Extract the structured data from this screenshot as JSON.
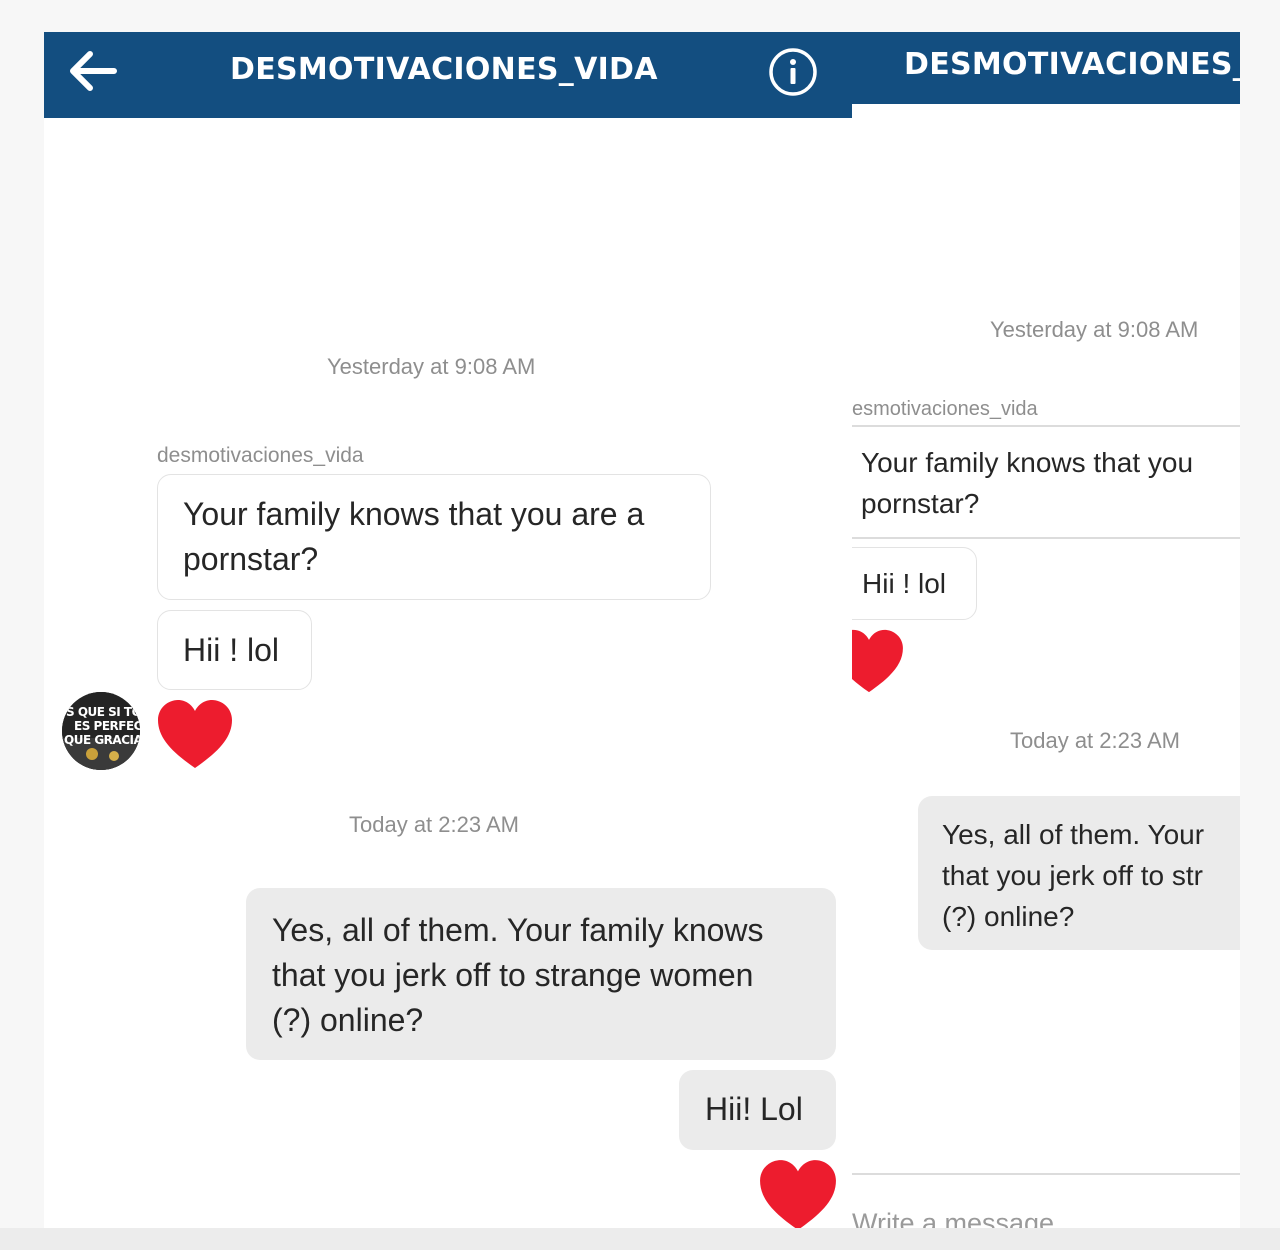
{
  "left_panel": {
    "header": {
      "title": "DESMOTIVACIONES_VIDA"
    },
    "messages": {
      "timestamp_1": "Yesterday at 9:08 AM",
      "sender": "desmotivaciones_vida",
      "incoming_1_line1": "Your family knows that you are a",
      "incoming_1_line2": "pornstar?",
      "incoming_2": "Hii ! lol",
      "avatar_line1": "S QUE SI TO",
      "avatar_line2": "ES PERFECTO",
      "avatar_line3": "QUE GRACIA TIEN",
      "timestamp_2": "Today at 2:23 AM",
      "outgoing_1_line1": "Yes, all of them. Your family knows",
      "outgoing_1_line2": "that you jerk off to strange women",
      "outgoing_1_line3": "(?) online?",
      "outgoing_2": "Hii! Lol"
    }
  },
  "right_panel": {
    "header": {
      "title": "DESMOTIVACIONES_VIDA"
    },
    "messages": {
      "timestamp_1": "Yesterday at 9:08 AM",
      "sender": "esmotivaciones_vida",
      "incoming_1_line1": "Your family knows that you",
      "incoming_1_line2": "pornstar?",
      "incoming_2": "Hii ! lol",
      "timestamp_2": "Today at 2:23 AM",
      "outgoing_1_line1": "Yes, all of them. Your",
      "outgoing_1_line2": "that you jerk off to str",
      "outgoing_1_line3": "(?) online?"
    },
    "composer": {
      "placeholder": "Write a message..."
    }
  },
  "icons": {
    "back": "arrow-left",
    "info": "info-circle",
    "reaction": "heart"
  },
  "colors": {
    "header_bg": "#134e80",
    "heart": "#ed1c2e",
    "outgoing_bubble": "#ebebeb",
    "muted_text": "#8e8e8e"
  }
}
